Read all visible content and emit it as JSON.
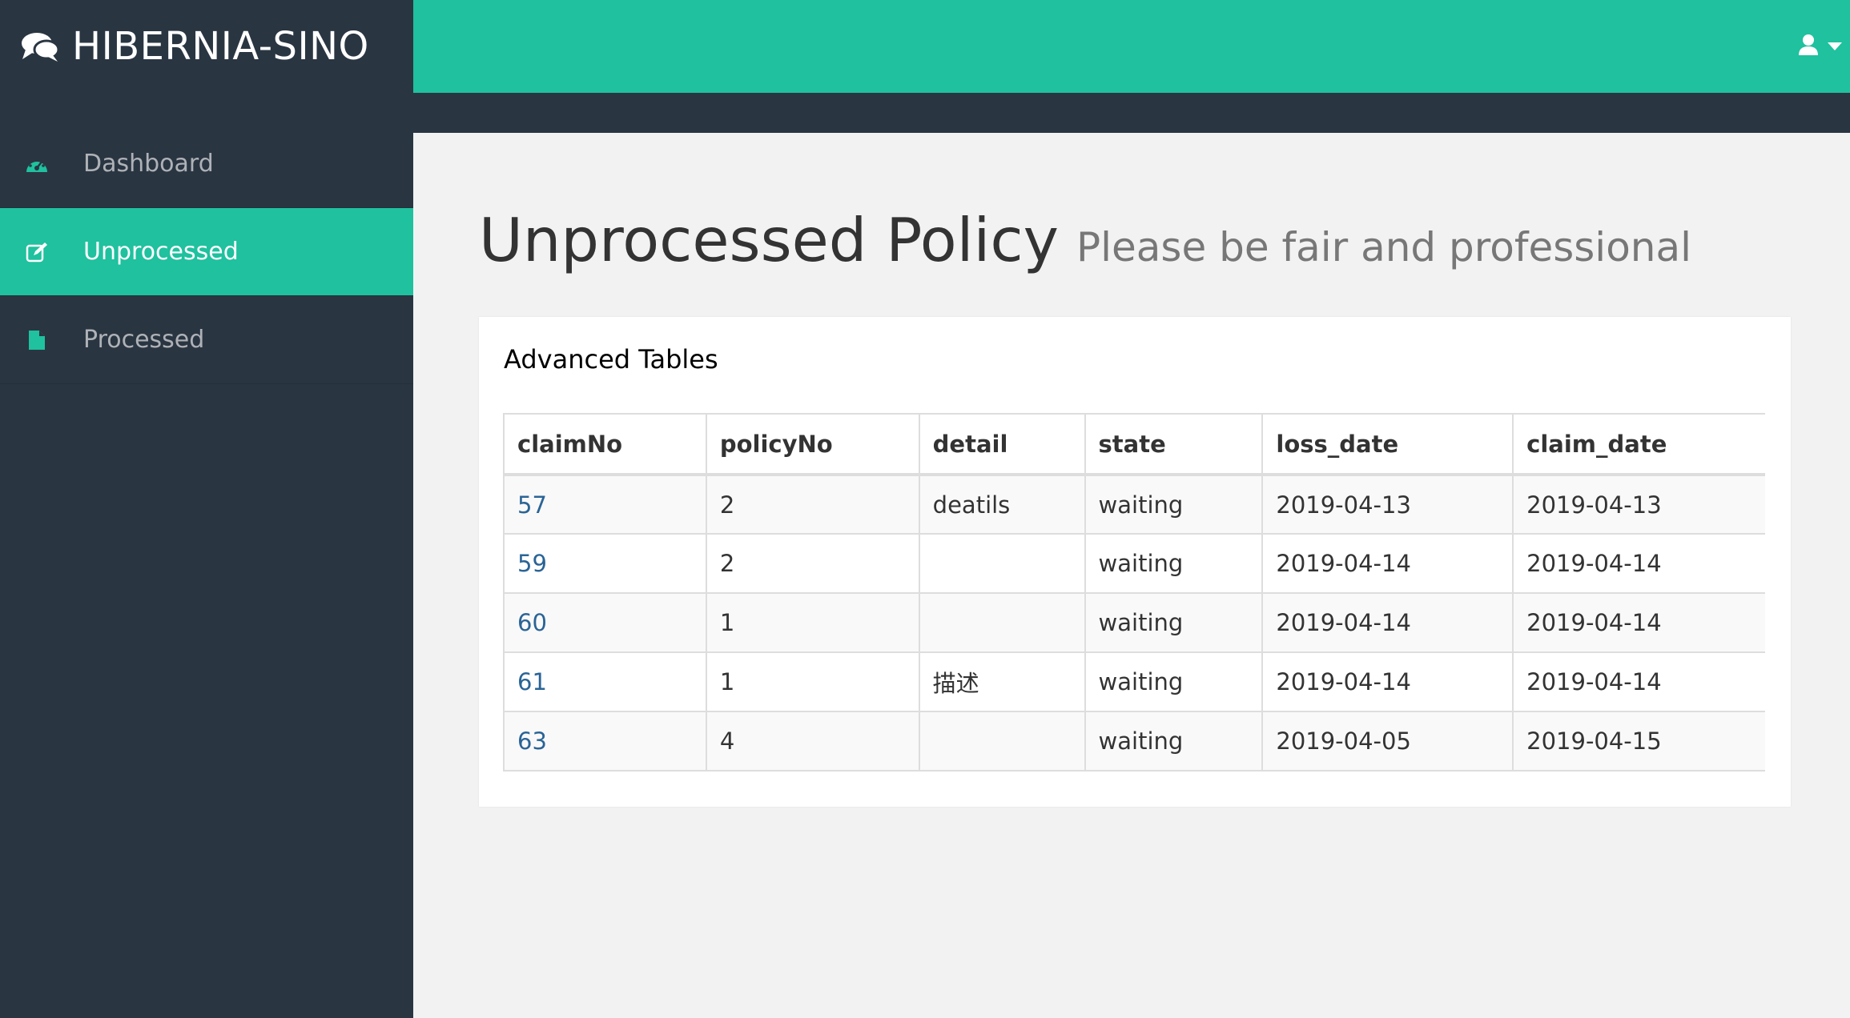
{
  "brand": {
    "name": "HIBERNIA-SINO",
    "icon": "comments-icon"
  },
  "header": {
    "user_icon": "user-icon",
    "caret_icon": "caret-down-icon"
  },
  "sidebar": {
    "items": [
      {
        "label": "Dashboard",
        "icon": "dashboard-icon",
        "active": false
      },
      {
        "label": "Unprocessed",
        "icon": "edit-icon",
        "active": true
      },
      {
        "label": "Processed",
        "icon": "file-icon",
        "active": false
      }
    ]
  },
  "page": {
    "title": "Unprocessed Policy",
    "subtitle": "Please be fair and professional"
  },
  "panel": {
    "heading": "Advanced Tables",
    "columns": [
      "claimNo",
      "policyNo",
      "detail",
      "state",
      "loss_date",
      "claim_date"
    ],
    "rows": [
      [
        "57",
        "2",
        "deatils",
        "waiting",
        "2019-04-13",
        "2019-04-13"
      ],
      [
        "59",
        "2",
        "",
        "waiting",
        "2019-04-14",
        "2019-04-14"
      ],
      [
        "60",
        "1",
        "",
        "waiting",
        "2019-04-14",
        "2019-04-14"
      ],
      [
        "61",
        "1",
        "描述",
        "waiting",
        "2019-04-14",
        "2019-04-14"
      ],
      [
        "63",
        "4",
        "",
        "waiting",
        "2019-04-05",
        "2019-04-15"
      ]
    ]
  },
  "colors": {
    "accent": "#1fc19e",
    "sidebar_bg": "#2a3542",
    "link": "#2a6496"
  }
}
